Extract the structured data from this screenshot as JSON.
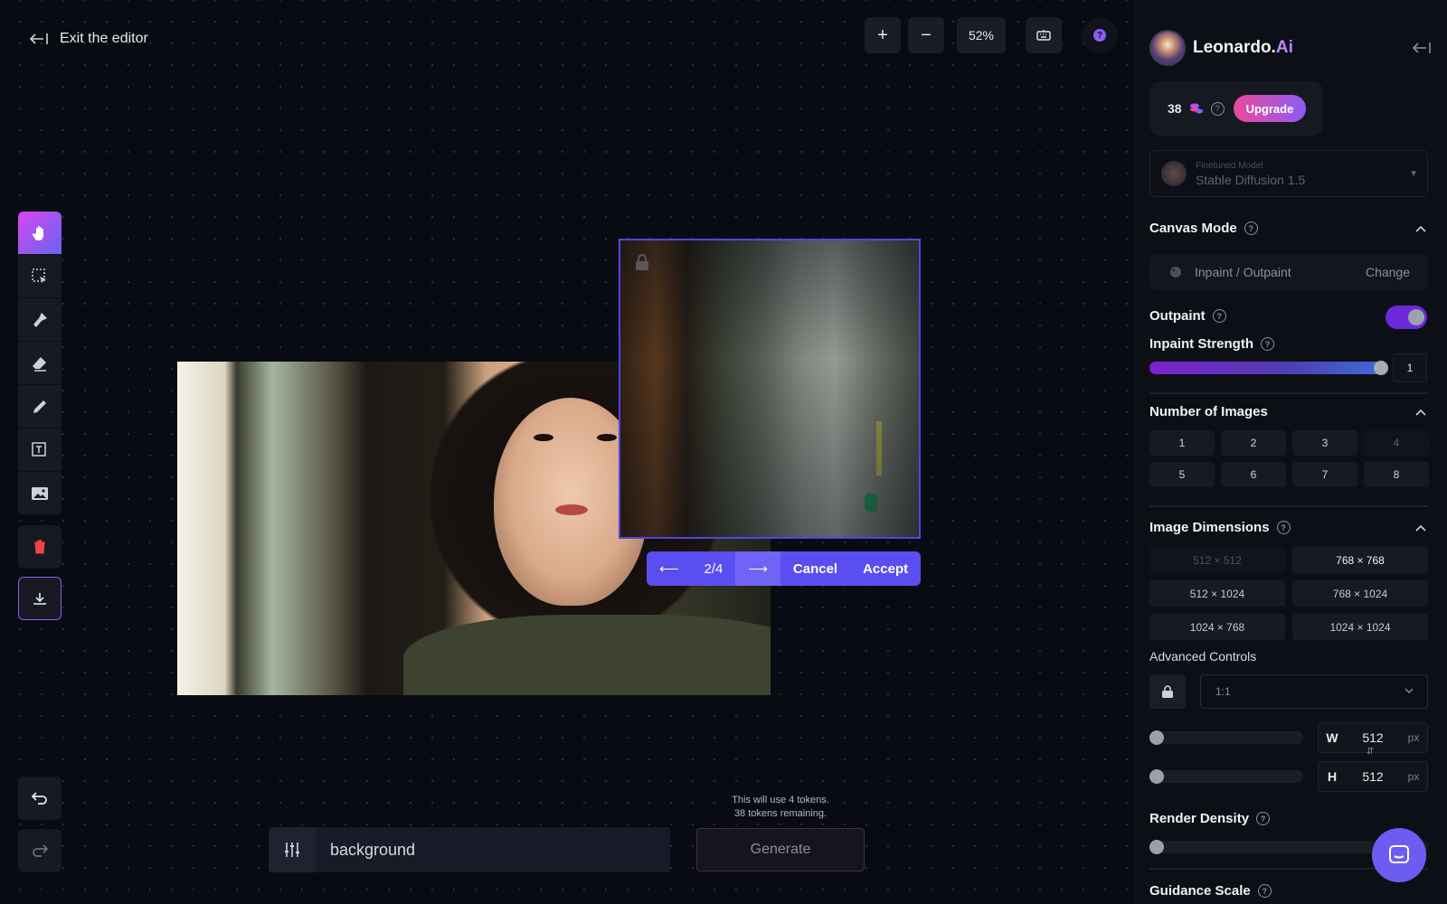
{
  "canvas": {
    "exit_label": "Exit the editor",
    "zoom": "52%",
    "nav": {
      "counter": "2/4",
      "cancel": "Cancel",
      "accept": "Accept"
    },
    "tokens_line1": "This will use 4 tokens.",
    "tokens_line2": "38 tokens remaining.",
    "prompt_value": "background",
    "generate_label": "Generate"
  },
  "panel": {
    "brand_name": "Leonardo.",
    "brand_suffix": "Ai",
    "credits": "38",
    "upgrade_label": "Upgrade",
    "model_label": "Finetuned Model",
    "model_value": "Stable Diffusion 1.5",
    "canvas_mode_title": "Canvas Mode",
    "mode_value": "Inpaint / Outpaint",
    "mode_change": "Change",
    "outpaint_label": "Outpaint",
    "outpaint_on": true,
    "inpaint_strength_label": "Inpaint Strength",
    "inpaint_strength_value": "1",
    "num_images_title": "Number of Images",
    "num_images": [
      "1",
      "2",
      "3",
      "4",
      "5",
      "6",
      "7",
      "8"
    ],
    "dimensions_title": "Image Dimensions",
    "dimensions": [
      "512 × 512",
      "768 × 768",
      "512 × 1024",
      "768 × 1024",
      "1024 × 768",
      "1024 × 1024"
    ],
    "advanced_label": "Advanced Controls",
    "aspect_ratio": "1:1",
    "width_label": "W",
    "width_value": "512",
    "height_label": "H",
    "height_value": "512",
    "unit": "px",
    "render_density_title": "Render Density",
    "guidance_title": "Guidance Scale"
  },
  "colors": {
    "accent": "#6d5cf2",
    "gradient_start": "#ec4899",
    "gradient_end": "#8b5cf6",
    "background": "#0a0c13"
  }
}
